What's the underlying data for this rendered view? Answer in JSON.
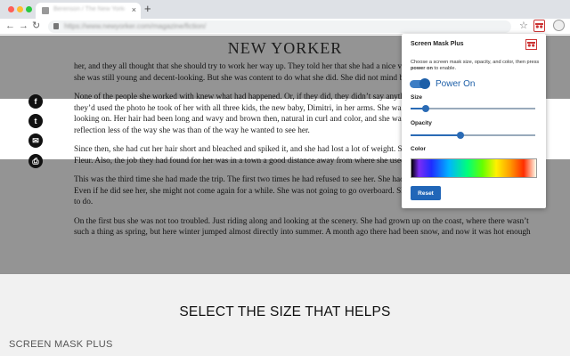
{
  "browser": {
    "tab_title": "Berenson / The New Yorker",
    "tab_close": "×",
    "new_tab": "+",
    "url": "https://www.newyorker.com/magazine/fiction/",
    "back": "←",
    "forward": "→",
    "reload": "↻",
    "star": "☆"
  },
  "page": {
    "masthead": "NEW YORKER",
    "paragraphs": [
      "her, and they all thought that she should try to work her way up. They told her that she had a nice voice and should get a job on the desk, that",
      "she was still young and decent-looking. But she was content to do what she did. She did not mind being behind the scenes or working late.",
      "None of the people she worked with knew what had happened. Or, if they did, they didn’t say anything. Sometimes she found the paper—",
      "they’d used the photo he took of her with all three kids, the new baby, Dimitri, in her arms. She was smiling, her eyes were half-closed,",
      "looking on. Her hair had been long and wavy and brown then, natural in curl and color, and she was wearing a blouse that looked soft—",
      "reflection less of the way she was than of the way he wanted to see her.",
      "Since then, she had cut her hair short and bleached and spiked it, and she had lost a lot of weight. She also used her middle name",
      "Fleur. Also, the job they had found for her was in a town a good distance away from where she used to live.",
      "This was the third time she had made the trip. The first two times he had refused to see her. She had almost made up her mind to quit trying.",
      "Even if he did see her, she might not come again for a while. She was not going to go overboard. She didn’t really know what she was going",
      "to do.",
      "On the first bus she was not too troubled. Just riding along and looking at the scenery. She had grown up on the coast, where there wasn’t",
      "such a thing as spring, but here winter jumped almost directly into summer. A month ago there had been snow, and now it was hot enough"
    ],
    "share": [
      "f",
      "t",
      "✉",
      "⎙"
    ]
  },
  "popup": {
    "title": "Screen Mask Plus",
    "description_1": "Choose a screen mask size, opacity, and color, then press ",
    "description_bold": "power on",
    "description_2": " to enable.",
    "power_label": "Power On",
    "power_on": true,
    "size_label": "Size",
    "size_value": 0.12,
    "opacity_label": "Opacity",
    "opacity_value": 0.4,
    "color_label": "Color",
    "reset_label": "Reset",
    "accent": "#2166b8"
  },
  "caption": {
    "headline": "SELECT THE SIZE THAT HELPS",
    "brand": "SCREEN MASK PLUS"
  }
}
